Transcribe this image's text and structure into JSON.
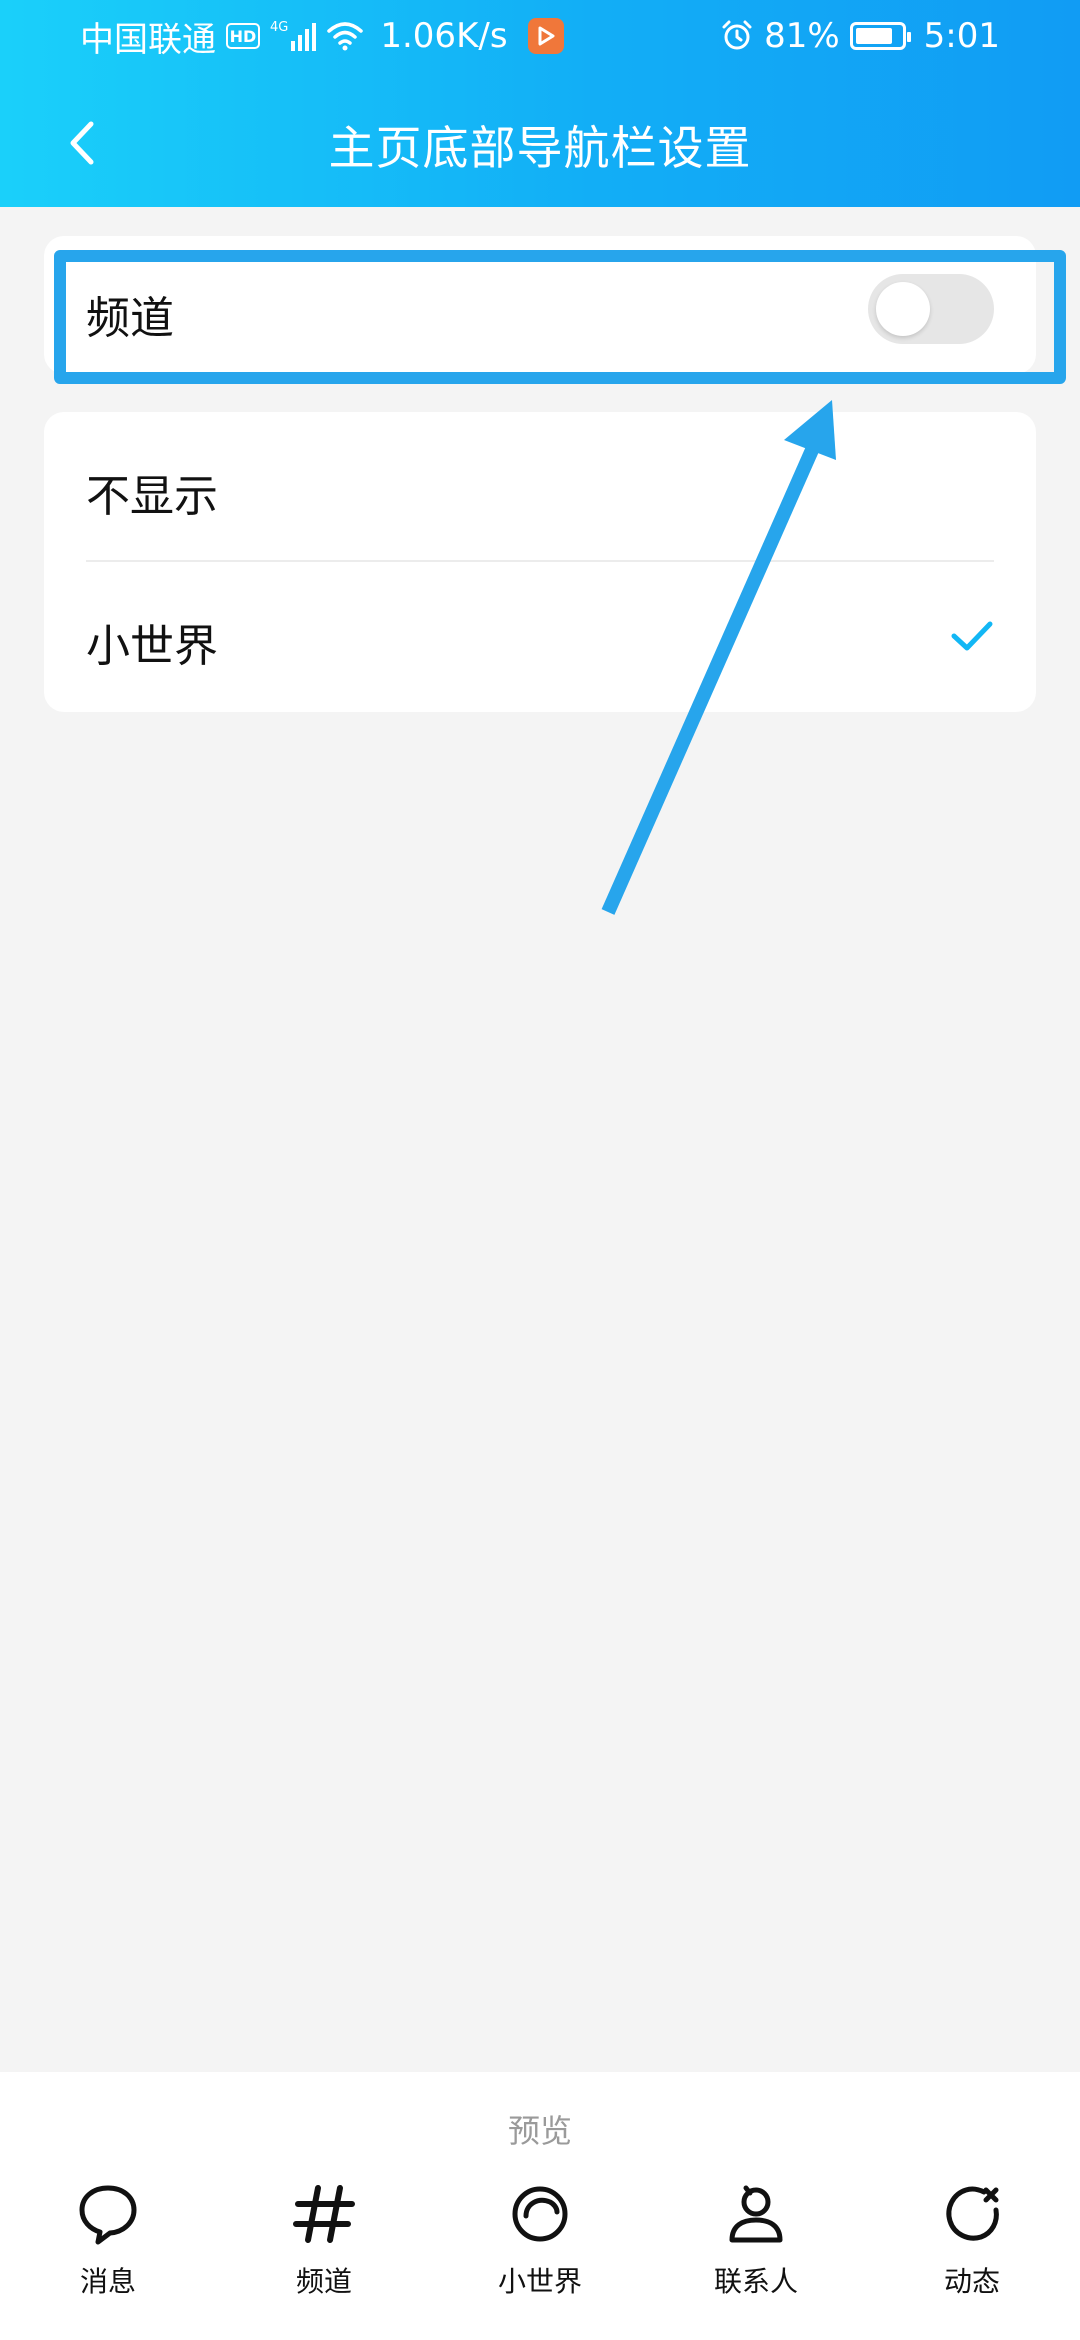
{
  "status_bar": {
    "carrier": "中国联通",
    "hd_badge": "HD",
    "network": "4G",
    "speed": "1.06K/s",
    "battery_percent": "81%",
    "battery_level": 0.81,
    "time": "5:01"
  },
  "header": {
    "title": "主页底部导航栏设置",
    "back_icon": "chevron-left-icon"
  },
  "toggle_setting": {
    "label": "频道",
    "enabled": false
  },
  "options": [
    {
      "label": "不显示",
      "selected": false
    },
    {
      "label": "小世界",
      "selected": true
    }
  ],
  "preview": {
    "label": "预览",
    "nav_items": [
      {
        "label": "消息",
        "icon": "chat-bubble-icon"
      },
      {
        "label": "频道",
        "icon": "hashtag-icon"
      },
      {
        "label": "小世界",
        "icon": "planet-icon"
      },
      {
        "label": "联系人",
        "icon": "person-icon"
      },
      {
        "label": "动态",
        "icon": "refresh-star-icon"
      }
    ]
  },
  "colors": {
    "header_start": "#1ad0fa",
    "header_end": "#119cf4",
    "annotation": "#27a5ec",
    "check": "#12b7f5",
    "switch_off": "#e6e6e6"
  }
}
